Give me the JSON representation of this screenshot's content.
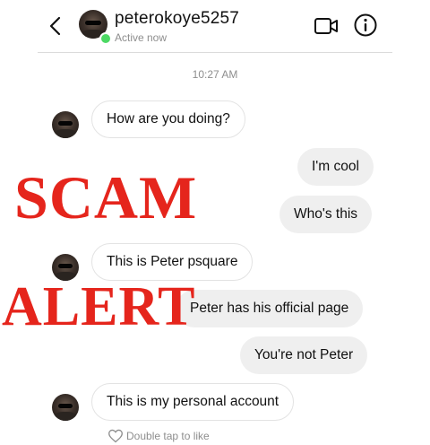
{
  "header": {
    "username": "peterokoye5257",
    "status": "Active now",
    "back_icon": "chevron-left-icon",
    "video_icon": "video-camera-icon",
    "info_icon": "info-icon",
    "online_color": "#4cd964"
  },
  "thread": {
    "timestamp": "10:27 AM",
    "messages": [
      {
        "sender": "them",
        "text": "How are you doing?"
      },
      {
        "sender": "me",
        "text": "I'm cool"
      },
      {
        "sender": "me",
        "text": "Who's this"
      },
      {
        "sender": "them",
        "text": "This is Peter psquare"
      },
      {
        "sender": "me",
        "text": "Peter has his official page"
      },
      {
        "sender": "me",
        "text": "You're not Peter"
      },
      {
        "sender": "them",
        "text": "This is my personal account"
      }
    ],
    "like_hint": "Double tap to like"
  },
  "overlay": {
    "line1": "SCAM",
    "line2": "ALERT",
    "color": "#e5251c"
  }
}
